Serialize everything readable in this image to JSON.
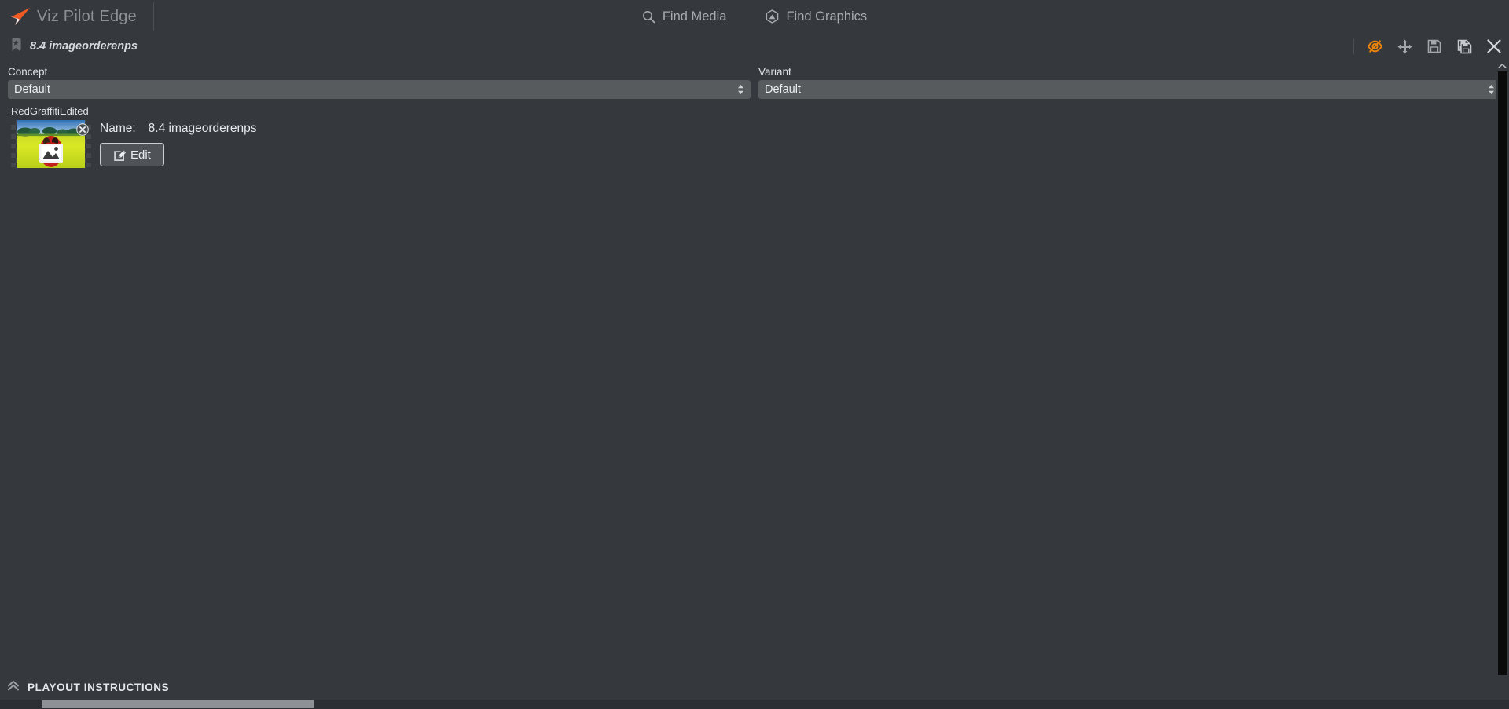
{
  "app": {
    "brand_name": "Viz Pilot Edge",
    "logo_icon": "arrow-logo-icon",
    "accent_color": "#ef5a24",
    "background_color": "#35383c",
    "panel_color": "#585b5e"
  },
  "topnav": {
    "items": [
      {
        "label": "Find Media",
        "icon": "search-icon",
        "name": "find-media"
      },
      {
        "label": "Find Graphics",
        "icon": "cube-icon",
        "name": "find-graphics"
      }
    ]
  },
  "document": {
    "icon": "bookmark-star-icon",
    "title": "8.4 imageorderenps",
    "tools": [
      {
        "name": "hide-preview",
        "icon": "eye-off-icon",
        "label": "Hide preview",
        "color": "#e8820c"
      },
      {
        "name": "move",
        "icon": "move-arrows-icon",
        "label": "Move",
        "color": "#a3a7ac"
      },
      {
        "name": "save",
        "icon": "floppy-save-icon",
        "label": "Save",
        "color": "#a3a7ac"
      },
      {
        "name": "save-as",
        "icon": "floppy-save-as-icon",
        "label": "Save As",
        "color": "#c6cacf"
      },
      {
        "name": "close",
        "icon": "close-x-icon",
        "label": "Close",
        "color": "#d6dade"
      }
    ]
  },
  "form": {
    "concept": {
      "label": "Concept",
      "value": "Default",
      "options": [
        "Default"
      ]
    },
    "variant": {
      "label": "Variant",
      "value": "Default",
      "options": [
        "Default"
      ]
    }
  },
  "media": {
    "caption": "RedGraffitiEdited",
    "thumbnail": {
      "alt": "rapeseed-field-photo",
      "remove_icon": "close-circle-icon",
      "overlay_icon": "image-placeholder-icon"
    },
    "name_label": "Name:",
    "name_value": "8.4 imageorderenps",
    "edit_button": {
      "label": "Edit",
      "icon": "edit-pencil-icon"
    }
  },
  "footer": {
    "collapse_icon": "chevron-double-up-icon",
    "label": "PLAYOUT INSTRUCTIONS"
  },
  "scrollbars": {
    "vertical": {
      "up_icon": "chevron-up-icon"
    },
    "horizontal": {
      "thumb_visible": true
    }
  }
}
